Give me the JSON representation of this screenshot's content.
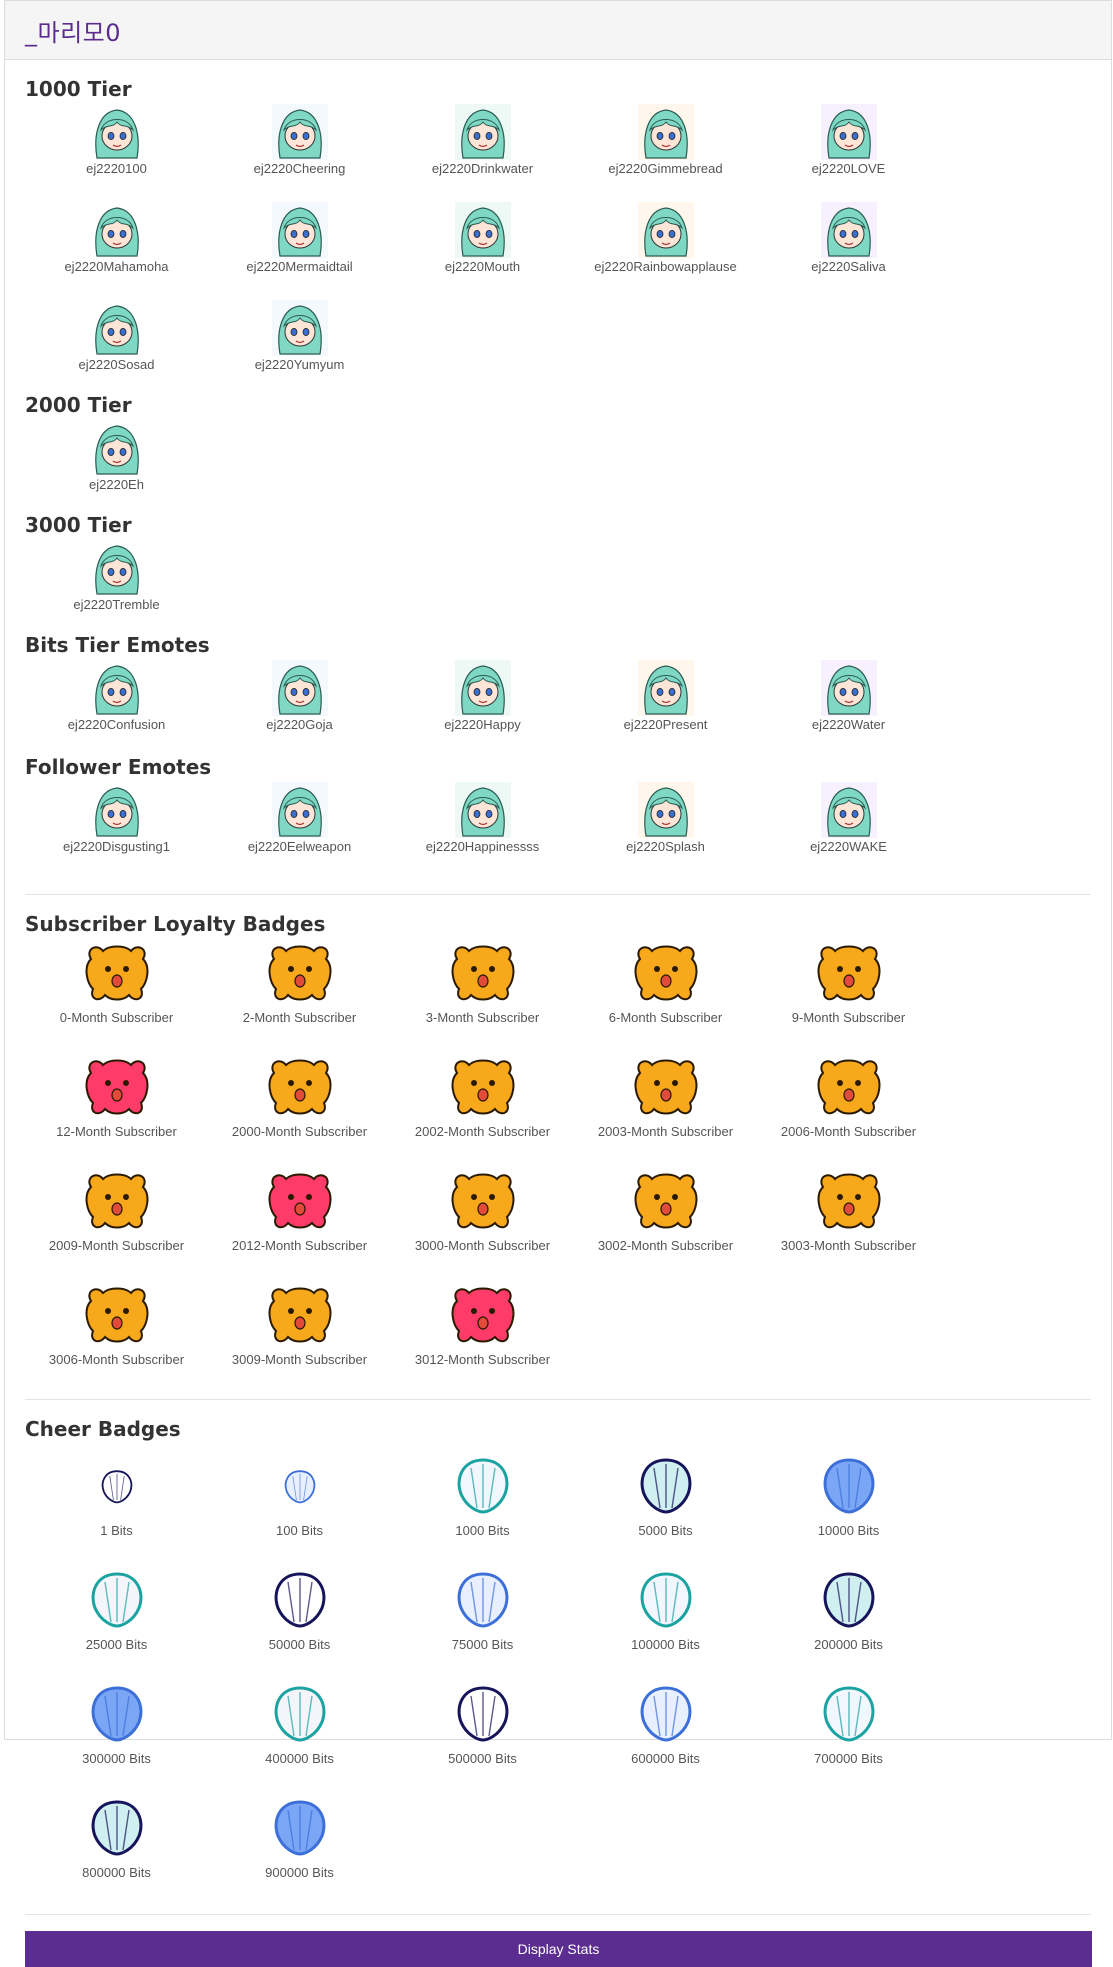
{
  "channel_title": "_마리모0",
  "sections": {
    "tier1000": {
      "title": "1000 Tier",
      "items": [
        "ej2220100",
        "ej2220Cheering",
        "ej2220Drinkwater",
        "ej2220Gimmebread",
        "ej2220LOVE",
        "ej2220Mahamoha",
        "ej2220Mermaidtail",
        "ej2220Mouth",
        "ej2220Rainbowapplause",
        "ej2220Saliva",
        "ej2220Sosad",
        "ej2220Yumyum"
      ]
    },
    "tier2000": {
      "title": "2000 Tier",
      "items": [
        "ej2220Eh"
      ]
    },
    "tier3000": {
      "title": "3000 Tier",
      "items": [
        "ej2220Tremble"
      ]
    },
    "bits": {
      "title": "Bits Tier Emotes",
      "items": [
        "ej2220Confusion",
        "ej2220Goja",
        "ej2220Happy",
        "ej2220Present",
        "ej2220Water"
      ]
    },
    "follower": {
      "title": "Follower Emotes",
      "items": [
        "ej2220Disgusting1",
        "ej2220Eelweapon",
        "ej2220Happinessss",
        "ej2220Splash",
        "ej2220WAKE"
      ]
    },
    "loyalty": {
      "title": "Subscriber Loyalty Badges",
      "items": [
        "0-Month Subscriber",
        "2-Month Subscriber",
        "3-Month Subscriber",
        "6-Month Subscriber",
        "9-Month Subscriber",
        "12-Month Subscriber",
        "2000-Month Subscriber",
        "2002-Month Subscriber",
        "2003-Month Subscriber",
        "2006-Month Subscriber",
        "2009-Month Subscriber",
        "2012-Month Subscriber",
        "3000-Month Subscriber",
        "3002-Month Subscriber",
        "3003-Month Subscriber",
        "3006-Month Subscriber",
        "3009-Month Subscriber",
        "3012-Month Subscriber"
      ]
    },
    "cheer": {
      "title": "Cheer Badges",
      "items": [
        "1 Bits",
        "100 Bits",
        "1000 Bits",
        "5000 Bits",
        "10000 Bits",
        "25000 Bits",
        "50000 Bits",
        "75000 Bits",
        "100000 Bits",
        "200000 Bits",
        "300000 Bits",
        "400000 Bits",
        "500000 Bits",
        "600000 Bits",
        "700000 Bits",
        "800000 Bits",
        "900000 Bits"
      ]
    }
  },
  "display_stats_button": "Display Stats",
  "colors": {
    "accent": "#5b2d90",
    "title": "#5b2d8c",
    "hair": "#7fd8c4",
    "badge_orange": "#f7a81b",
    "shell_blue": "#3d6fd9"
  }
}
